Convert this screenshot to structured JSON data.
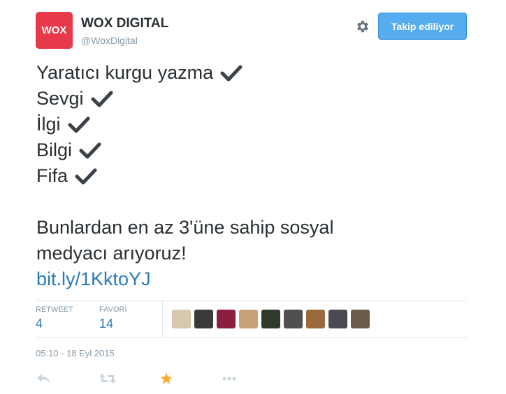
{
  "account": {
    "logo_text": "WOX",
    "name": "WOX DIGITAL",
    "handle": "@WoxDigital"
  },
  "header": {
    "follow_button_label": "Takip ediliyor",
    "settings_icon": "gear-icon"
  },
  "tweet": {
    "lines": [
      "Yaratıcı kurgu yazma",
      "Sevgi",
      "İlgi",
      "Bilgi",
      "Fifa"
    ],
    "check_icon": "checkmark-icon",
    "paragraph_line1": "Bunlardan en az 3'üne sahip sosyal",
    "paragraph_line2": "medyacı arıyoruz!",
    "link": "bit.ly/1KktoYJ"
  },
  "stats": {
    "retweet_label": "RETWEET",
    "retweet_count": "4",
    "favorite_label": "FAVORİ",
    "favorite_count": "14"
  },
  "favorited_by_avatars": [
    {
      "color": "#d8c8b0"
    },
    {
      "color": "#3a3a3a"
    },
    {
      "color": "#8a2040"
    },
    {
      "color": "#c9a27a"
    },
    {
      "color": "#2f3a2c"
    },
    {
      "color": "#505050"
    },
    {
      "color": "#9a6a3e"
    },
    {
      "color": "#4a4a52"
    },
    {
      "color": "#6a5a4a"
    }
  ],
  "timestamp": "05:10 - 18 Eyl 2015",
  "actions": {
    "reply_icon": "reply-icon",
    "retweet_icon": "retweet-icon",
    "favorite_icon": "star-icon",
    "more_icon": "more-icon",
    "favorite_color": "#ffac33",
    "icon_color": "#ccd6dd"
  }
}
